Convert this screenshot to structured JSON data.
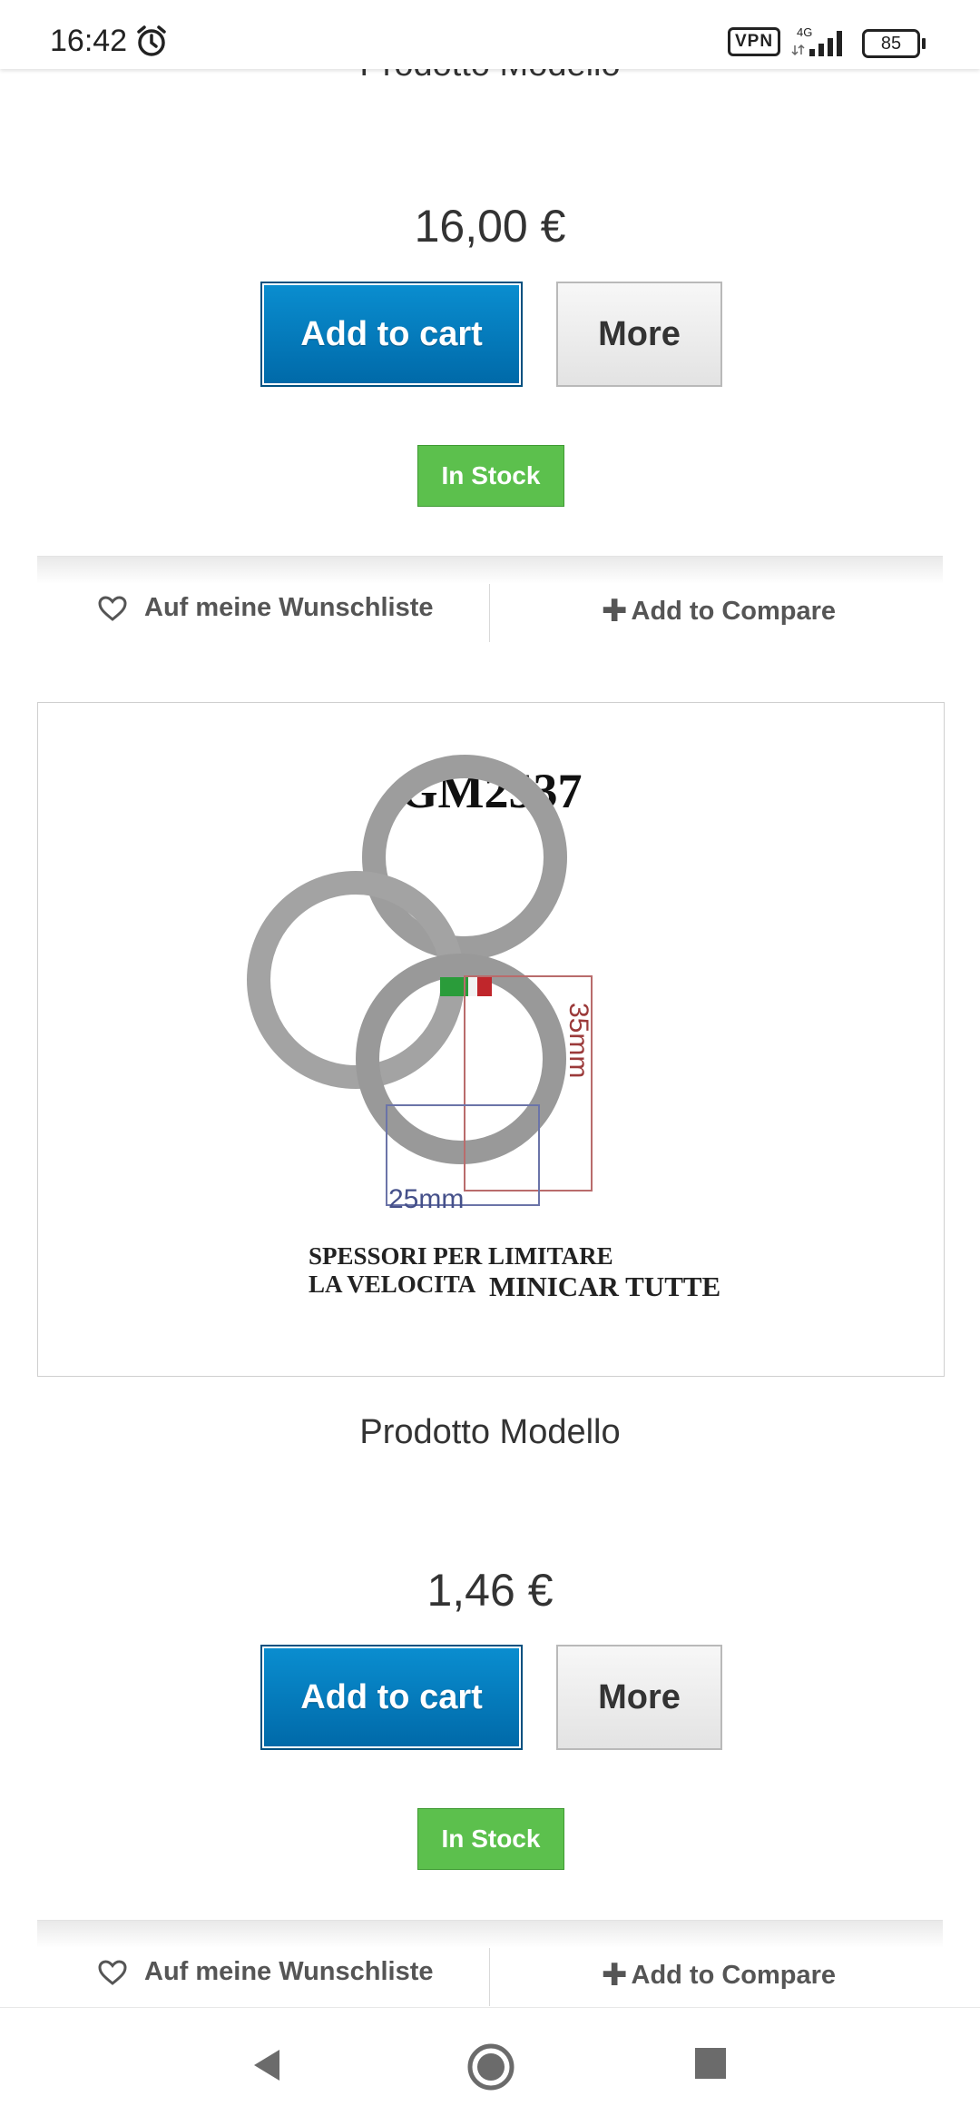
{
  "status_bar": {
    "time": "16:42",
    "vpn_label": "VPN",
    "network_label": "4G",
    "battery": "85"
  },
  "products": [
    {
      "title": "Prodotto Modello",
      "price": "16,00 €",
      "add_to_cart_label": "Add to cart",
      "more_label": "More",
      "stock_label": "In Stock",
      "wishlist_label": "Auf meine Wunschliste",
      "compare_label": "Add to Compare"
    },
    {
      "image": {
        "code": "GM2537",
        "caption_line1": "SPESSORI PER LIMITARE",
        "caption_line2": "LA VELOCITA",
        "caption_line2b": "MINICAR TUTTE",
        "dim_horizontal": "25mm",
        "dim_vertical": "35mm"
      },
      "title": "Prodotto Modello",
      "price": "1,46 €",
      "add_to_cart_label": "Add to cart",
      "more_label": "More",
      "stock_label": "In Stock",
      "wishlist_label": "Auf meine Wunschliste",
      "compare_label": "Add to Compare"
    }
  ],
  "colors": {
    "cart_button": "#0a7fc4",
    "stock_badge": "#5cc04d"
  },
  "nav_icons": [
    "back-icon",
    "home-icon",
    "recents-icon"
  ]
}
